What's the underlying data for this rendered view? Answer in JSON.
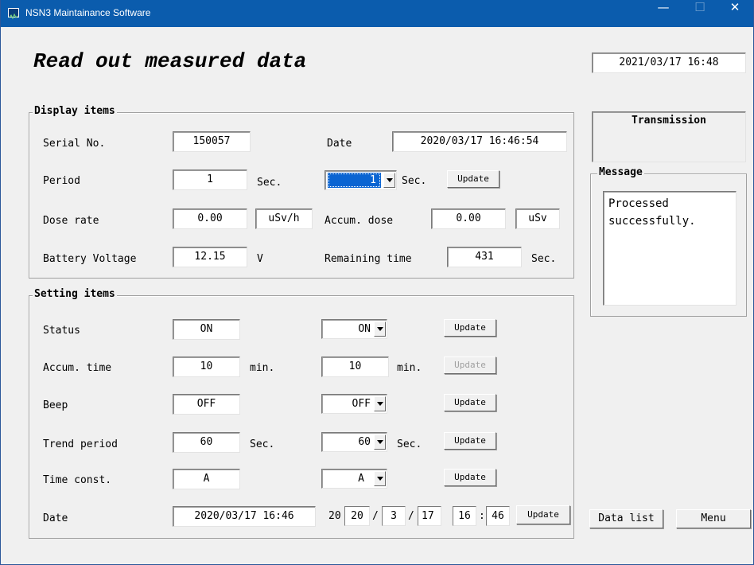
{
  "window": {
    "title": "NSN3 Maintainance Software",
    "minimize": "—",
    "maximize": "☐",
    "close": "✕"
  },
  "header": {
    "page_title": "Read out measured data",
    "current_time": "2021/03/17 16:48"
  },
  "display": {
    "group_label": "Display items",
    "serial_label": "Serial No.",
    "serial_value": "150057",
    "date_label": "Date",
    "date_value": "2020/03/17 16:46:54",
    "period_label": "Period",
    "period_value": "1",
    "period_unit": "Sec.",
    "period_select": "1",
    "period_select_unit": "Sec.",
    "period_update": "Update",
    "dose_label": "Dose rate",
    "dose_value": "0.00",
    "dose_unit": "uSv/h",
    "accum_label": "Accum. dose",
    "accum_value": "0.00",
    "accum_unit": "uSv",
    "battery_label": "Battery Voltage",
    "battery_value": "12.15",
    "battery_unit": "V",
    "remaining_label": "Remaining time",
    "remaining_value": "431",
    "remaining_unit": "Sec."
  },
  "settings": {
    "group_label": "Setting items",
    "status_label": "Status",
    "status_value": "ON",
    "status_select": "ON",
    "status_update": "Update",
    "accum_label": "Accum. time",
    "accum_value": "10",
    "accum_unit": "min.",
    "accum_input": "10",
    "accum_input_unit": "min.",
    "accum_update": "Update",
    "beep_label": "Beep",
    "beep_value": "OFF",
    "beep_select": "OFF",
    "beep_update": "Update",
    "trend_label": "Trend period",
    "trend_value": "60",
    "trend_unit": "Sec.",
    "trend_select": "60",
    "trend_select_unit": "Sec.",
    "trend_update": "Update",
    "timeconst_label": "Time const.",
    "timeconst_value": "A",
    "timeconst_select": "A",
    "timeconst_update": "Update",
    "date_label": "Date",
    "date_value": "2020/03/17 16:46",
    "year_prefix": "20",
    "year_value": "20",
    "sep1": "/",
    "month_value": "3",
    "sep2": "/",
    "day_value": "17",
    "hour_value": "16",
    "sep3": ":",
    "minute_value": "46",
    "date_update": "Update"
  },
  "side": {
    "transmission_label": "Transmission",
    "message_label": "Message",
    "message_text": "Processed\nsuccessfully.",
    "data_list": "Data list",
    "menu": "Menu"
  }
}
